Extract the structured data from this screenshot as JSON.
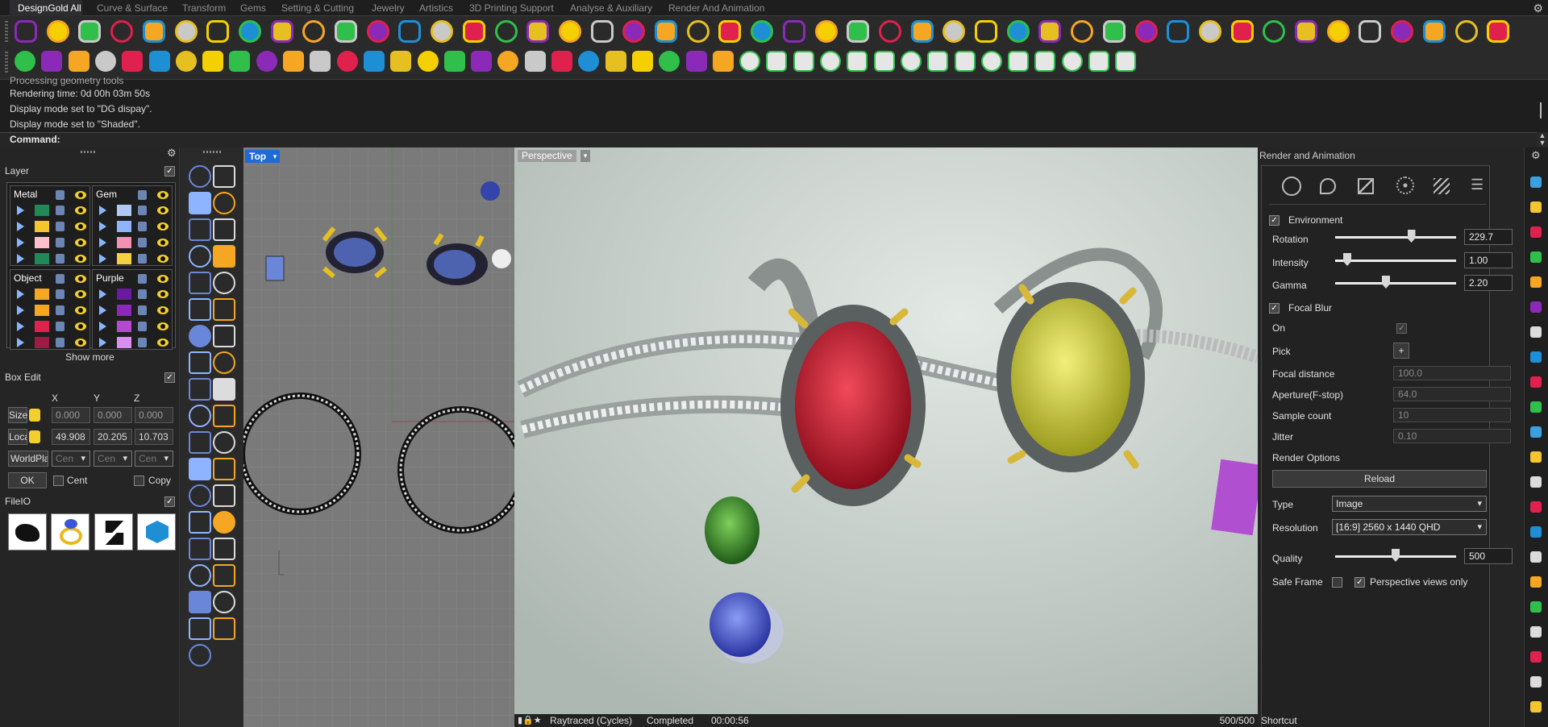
{
  "tabs": [
    "DesignGold All",
    "Curve & Surface",
    "Transform",
    "Gems",
    "Setting & Cutting",
    "Jewelry",
    "Artistics",
    "3D Printing Support",
    "Analyse & Auxiliary",
    "Render And Animation"
  ],
  "command_history": [
    "Processing geometry tools",
    "Rendering time: 0d 00h 03m 50s",
    "Display mode set to \"DG dispay\".",
    "Display mode set to \"Shaded\"."
  ],
  "command_label": "Command:",
  "layer": {
    "title": "Layer",
    "groups": [
      {
        "name": "Metal",
        "colors": [
          "#1f8a57",
          "#f5c530",
          "#ffc0cb",
          "#1f8a57"
        ]
      },
      {
        "name": "Gem",
        "colors": [
          "#b0c8f5",
          "#8fb4ff",
          "#f58fb4",
          "#f5d040"
        ]
      },
      {
        "name": "Object",
        "colors": [
          "#f5a623",
          "#f5a623",
          "#e0204d",
          "#9b1b45"
        ]
      },
      {
        "name": "Purple",
        "colors": [
          "#6a1aa0",
          "#8b2ab8",
          "#b54ad0",
          "#d88ff0"
        ]
      }
    ],
    "show_more": "Show more"
  },
  "boxedit": {
    "title": "Box Edit",
    "axes": [
      "X",
      "Y",
      "Z"
    ],
    "size_label": "Size",
    "size": [
      "0.000",
      "0.000",
      "0.000"
    ],
    "local_label": "Loca",
    "local": [
      "49.908",
      "20.205",
      "10.703"
    ],
    "world_label": "WorldPla",
    "world": [
      "Cen",
      "Cen",
      "Cen"
    ],
    "ok": "OK",
    "cent": "Cent",
    "copy": "Copy"
  },
  "fileio": {
    "title": "FileIO"
  },
  "viewports": {
    "top": "Top",
    "perspective": "Perspective"
  },
  "status": {
    "renderer": "Raytraced (Cycles)",
    "state": "Completed",
    "time": "00:00:56",
    "samples": "500/500"
  },
  "render_panel": {
    "title": "Render and Animation",
    "environment": "Environment",
    "rotation_label": "Rotation",
    "rotation": "229.7",
    "rotation_frac": 0.63,
    "intensity_label": "Intensity",
    "intensity": "1.00",
    "intensity_frac": 0.1,
    "gamma_label": "Gamma",
    "gamma": "2.20",
    "gamma_frac": 0.42,
    "focal_blur": "Focal Blur",
    "on_label": "On",
    "pick_label": "Pick",
    "pick_btn": "+",
    "focal_distance_label": "Focal distance",
    "focal_distance": "100.0",
    "aperture_label": "Aperture(F-stop)",
    "aperture": "64.0",
    "sample_count_label": "Sample count",
    "sample_count": "10",
    "jitter_label": "Jitter",
    "jitter": "0.10",
    "render_options": "Render Options",
    "reload": "Reload",
    "type_label": "Type",
    "type": "Image",
    "resolution_label": "Resolution",
    "resolution": "[16:9] 2560 x 1440 QHD",
    "quality_label": "Quality",
    "quality": "500",
    "quality_frac": 0.5,
    "safe_frame": "Safe Frame",
    "persp_only": "Perspective views only",
    "shortcut": "Shortcut"
  }
}
